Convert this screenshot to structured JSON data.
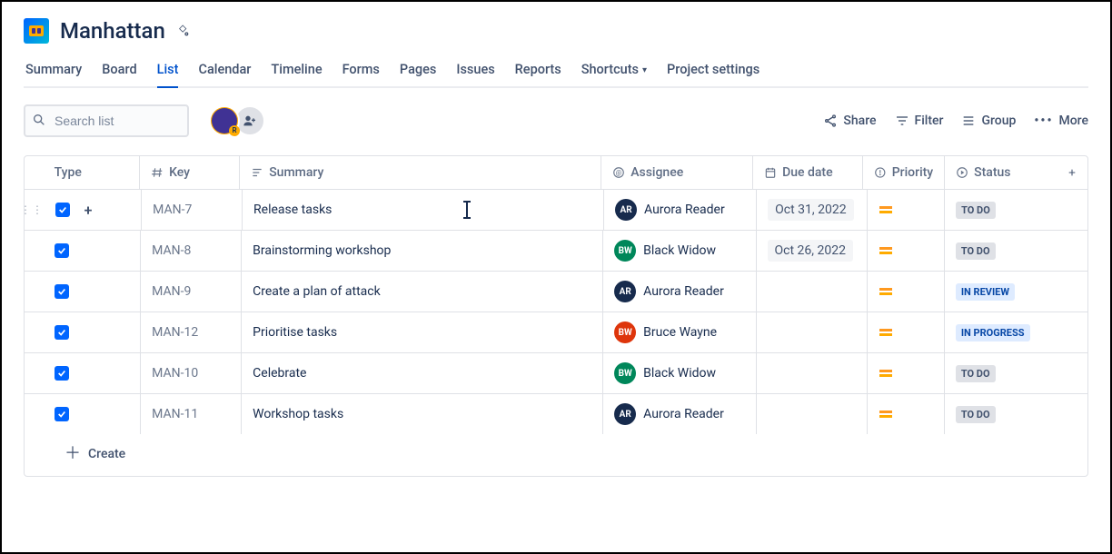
{
  "header": {
    "project_name": "Manhattan"
  },
  "tabs": [
    {
      "label": "Summary",
      "active": false
    },
    {
      "label": "Board",
      "active": false
    },
    {
      "label": "List",
      "active": true
    },
    {
      "label": "Calendar",
      "active": false
    },
    {
      "label": "Timeline",
      "active": false
    },
    {
      "label": "Forms",
      "active": false
    },
    {
      "label": "Pages",
      "active": false
    },
    {
      "label": "Issues",
      "active": false
    },
    {
      "label": "Reports",
      "active": false
    },
    {
      "label": "Shortcuts",
      "active": false,
      "dropdown": true
    },
    {
      "label": "Project settings",
      "active": false
    }
  ],
  "toolbar": {
    "search_placeholder": "Search list",
    "share": "Share",
    "filter": "Filter",
    "group": "Group",
    "more": "More"
  },
  "columns": {
    "type": "Type",
    "key": "Key",
    "summary": "Summary",
    "assignee": "Assignee",
    "due": "Due date",
    "priority": "Priority",
    "status": "Status"
  },
  "rows": [
    {
      "key": "MAN-7",
      "summary": "Release tasks",
      "assignee": {
        "name": "Aurora Reader",
        "initials": "AR",
        "color": "#172B4D"
      },
      "due": "Oct 31, 2022",
      "status": {
        "label": "TO DO",
        "class": "st-todo"
      },
      "editing": true,
      "drag": true,
      "show_add": true
    },
    {
      "key": "MAN-8",
      "summary": "Brainstorming workshop",
      "assignee": {
        "name": "Black Widow",
        "initials": "BW",
        "color": "#00875A"
      },
      "due": "Oct 26, 2022",
      "status": {
        "label": "TO DO",
        "class": "st-todo"
      }
    },
    {
      "key": "MAN-9",
      "summary": "Create a plan of attack",
      "assignee": {
        "name": "Aurora Reader",
        "initials": "AR",
        "color": "#172B4D"
      },
      "due": "",
      "status": {
        "label": "IN REVIEW",
        "class": "st-inreview"
      }
    },
    {
      "key": "MAN-12",
      "summary": "Prioritise tasks",
      "assignee": {
        "name": "Bruce Wayne",
        "initials": "BW",
        "color": "#DE350B"
      },
      "due": "",
      "status": {
        "label": "IN PROGRESS",
        "class": "st-inprogress"
      }
    },
    {
      "key": "MAN-10",
      "summary": "Celebrate",
      "assignee": {
        "name": "Black Widow",
        "initials": "BW",
        "color": "#00875A"
      },
      "due": "",
      "status": {
        "label": "TO DO",
        "class": "st-todo"
      }
    },
    {
      "key": "MAN-11",
      "summary": "Workshop tasks",
      "assignee": {
        "name": "Aurora Reader",
        "initials": "AR",
        "color": "#172B4D"
      },
      "due": "",
      "status": {
        "label": "TO DO",
        "class": "st-todo"
      }
    }
  ],
  "create_label": "Create"
}
